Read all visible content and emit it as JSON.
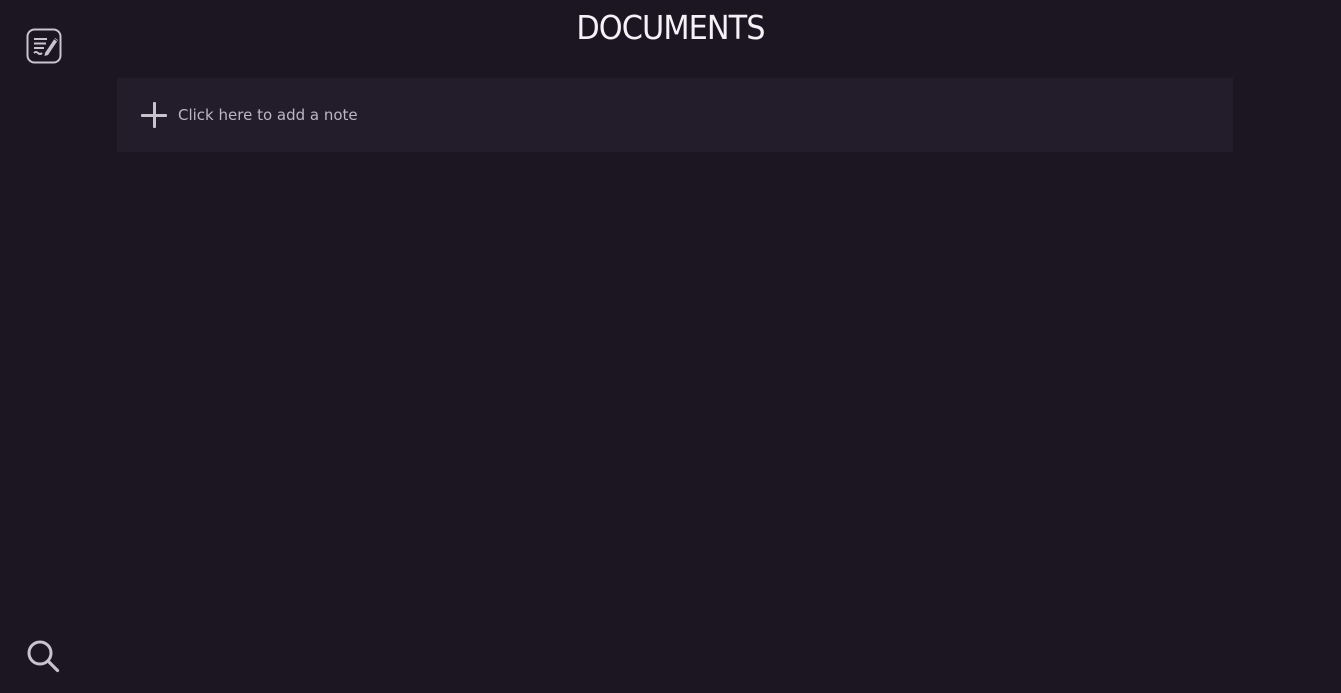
{
  "sidebar": {
    "top_button_icon": "edit-notes-icon",
    "bottom_button_icon": "search-icon"
  },
  "header": {
    "title": "DOCUMENTS"
  },
  "main": {
    "add_note_label": "Click here to add a note",
    "add_note_icon": "plus-icon"
  },
  "colors": {
    "background": "#1c1622",
    "panel": "#231c2b",
    "title_text": "#f4f1f7",
    "muted_text": "#bcb6c4",
    "icon": "#c9c3d0"
  }
}
